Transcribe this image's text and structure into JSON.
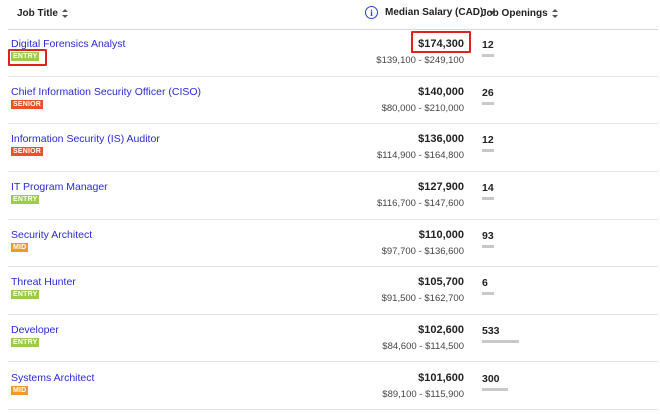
{
  "columns": {
    "job_title": "Job Title",
    "median_salary": "Median Salary (CAD)",
    "job_openings": "Job Openings"
  },
  "rows": [
    {
      "title": "Digital Forensics Analyst",
      "level": "ENTRY",
      "median": "$174,300",
      "range": "$139,100 - $249,100",
      "openings": "12",
      "openings_value": 12
    },
    {
      "title": "Chief Information Security Officer (CISO)",
      "level": "SENIOR",
      "median": "$140,000",
      "range": "$80,000 - $210,000",
      "openings": "26",
      "openings_value": 26
    },
    {
      "title": "Information Security (IS) Auditor",
      "level": "SENIOR",
      "median": "$136,000",
      "range": "$114,900 - $164,800",
      "openings": "12",
      "openings_value": 12
    },
    {
      "title": "IT Program Manager",
      "level": "ENTRY",
      "median": "$127,900",
      "range": "$116,700 - $147,600",
      "openings": "14",
      "openings_value": 14
    },
    {
      "title": "Security Architect",
      "level": "MID",
      "median": "$110,000",
      "range": "$97,700 - $136,600",
      "openings": "93",
      "openings_value": 93
    },
    {
      "title": "Threat Hunter",
      "level": "ENTRY",
      "median": "$105,700",
      "range": "$91,500 - $162,700",
      "openings": "6",
      "openings_value": 6
    },
    {
      "title": "Developer",
      "level": "ENTRY",
      "median": "$102,600",
      "range": "$84,600 - $114,500",
      "openings": "533",
      "openings_value": 533
    },
    {
      "title": "Systems Architect",
      "level": "MID",
      "median": "$101,600",
      "range": "$89,100 - $115,900",
      "openings": "300",
      "openings_value": 300
    }
  ],
  "level_colors": {
    "ENTRY": "#9ccc4a",
    "SENIOR": "#e8522a",
    "MID": "#f09a2c"
  },
  "link_color": "#2a2ad8",
  "highlight_color": "#e0221c"
}
